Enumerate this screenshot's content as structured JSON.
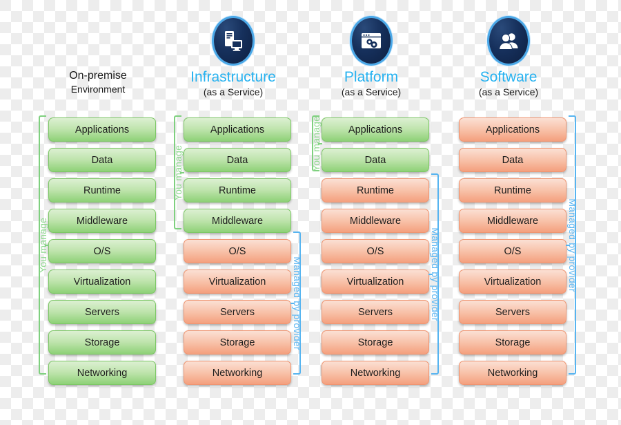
{
  "diagram": {
    "layers": [
      "Applications",
      "Data",
      "Runtime",
      "Middleware",
      "O/S",
      "Virtualization",
      "Servers",
      "Storage",
      "Networking"
    ],
    "you_manage_label": "You manage",
    "managed_by_provider_label": "Managed by provider",
    "colors": {
      "green_fill": "#bfe4ad",
      "green_border": "#7cc765",
      "salmon_fill": "#f8c3ab",
      "salmon_border": "#ef9470",
      "green_bracket": "#7fd07f",
      "blue_bracket": "#56b4f0",
      "title_blue": "#27b2f0",
      "icon_navy": "#16305c"
    },
    "columns": [
      {
        "id": "on-premise",
        "title": "On-premise",
        "subtitle": "Environment",
        "title_color": "dark",
        "icon": null,
        "you_manage_count": 9,
        "managed_by_provider_count": 0,
        "layers": [
          {
            "label": "Applications",
            "owner": "you"
          },
          {
            "label": "Data",
            "owner": "you"
          },
          {
            "label": "Runtime",
            "owner": "you"
          },
          {
            "label": "Middleware",
            "owner": "you"
          },
          {
            "label": "O/S",
            "owner": "you"
          },
          {
            "label": "Virtualization",
            "owner": "you"
          },
          {
            "label": "Servers",
            "owner": "you"
          },
          {
            "label": "Storage",
            "owner": "you"
          },
          {
            "label": "Networking",
            "owner": "you"
          }
        ]
      },
      {
        "id": "infrastructure",
        "title": "Infrastructure",
        "subtitle": "(as a Service)",
        "title_color": "blue",
        "icon": "server-monitor-icon",
        "you_manage_count": 4,
        "managed_by_provider_count": 5,
        "layers": [
          {
            "label": "Applications",
            "owner": "you"
          },
          {
            "label": "Data",
            "owner": "you"
          },
          {
            "label": "Runtime",
            "owner": "you"
          },
          {
            "label": "Middleware",
            "owner": "you"
          },
          {
            "label": "O/S",
            "owner": "provider"
          },
          {
            "label": "Virtualization",
            "owner": "provider"
          },
          {
            "label": "Servers",
            "owner": "provider"
          },
          {
            "label": "Storage",
            "owner": "provider"
          },
          {
            "label": "Networking",
            "owner": "provider"
          }
        ]
      },
      {
        "id": "platform",
        "title": "Platform",
        "subtitle": "(as a Service)",
        "title_color": "blue",
        "icon": "browser-gears-icon",
        "you_manage_count": 2,
        "managed_by_provider_count": 7,
        "layers": [
          {
            "label": "Applications",
            "owner": "you"
          },
          {
            "label": "Data",
            "owner": "you"
          },
          {
            "label": "Runtime",
            "owner": "provider"
          },
          {
            "label": "Middleware",
            "owner": "provider"
          },
          {
            "label": "O/S",
            "owner": "provider"
          },
          {
            "label": "Virtualization",
            "owner": "provider"
          },
          {
            "label": "Servers",
            "owner": "provider"
          },
          {
            "label": "Storage",
            "owner": "provider"
          },
          {
            "label": "Networking",
            "owner": "provider"
          }
        ]
      },
      {
        "id": "software",
        "title": "Software",
        "subtitle": "(as a Service)",
        "title_color": "blue",
        "icon": "users-icon",
        "you_manage_count": 0,
        "managed_by_provider_count": 9,
        "layers": [
          {
            "label": "Applications",
            "owner": "provider"
          },
          {
            "label": "Data",
            "owner": "provider"
          },
          {
            "label": "Runtime",
            "owner": "provider"
          },
          {
            "label": "Middleware",
            "owner": "provider"
          },
          {
            "label": "O/S",
            "owner": "provider"
          },
          {
            "label": "Virtualization",
            "owner": "provider"
          },
          {
            "label": "Servers",
            "owner": "provider"
          },
          {
            "label": "Storage",
            "owner": "provider"
          },
          {
            "label": "Networking",
            "owner": "provider"
          }
        ]
      }
    ]
  }
}
